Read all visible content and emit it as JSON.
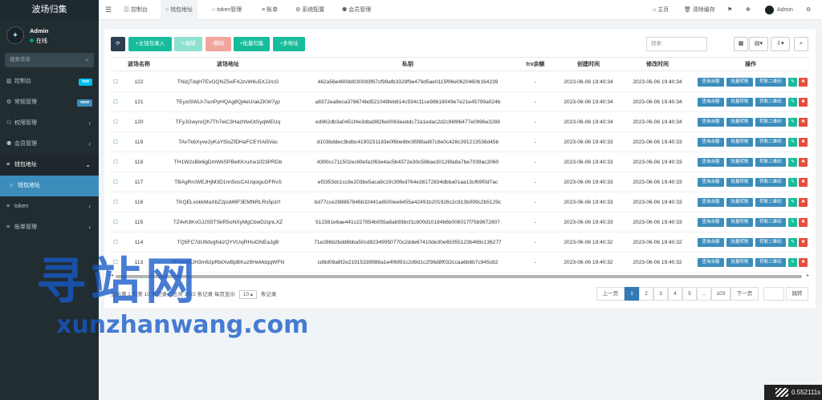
{
  "app": {
    "title": "波场归集"
  },
  "user": {
    "name": "Admin",
    "status": "在线"
  },
  "sidebar": {
    "search_placeholder": "搜索菜单",
    "items": [
      {
        "label": "控制台",
        "badge": "hot",
        "badge_color": "#00c0ef"
      },
      {
        "label": "常规管理",
        "badge": "new",
        "badge_color": "#3c8dbc"
      },
      {
        "label": "权限管理"
      },
      {
        "label": "会员管理"
      },
      {
        "label": "钱包地址"
      },
      {
        "label": "钱包地址"
      },
      {
        "label": "token"
      },
      {
        "label": "账单管理"
      }
    ]
  },
  "topbar": {
    "tabs": [
      "控制台",
      "钱包地址",
      "token管理",
      "账单",
      "系统配置",
      "会员管理"
    ],
    "home": "主页",
    "clear_cache": "清除缓存",
    "admin": "Admin"
  },
  "toolbar": {
    "add_main": "+主钱包录入",
    "edit": "编辑",
    "delete": "删除",
    "batch_collect": "+批量归集",
    "multi_address": "+多地址",
    "search_placeholder": "搜索"
  },
  "table": {
    "headers": [
      "波场名称",
      "波场地址",
      "私钥",
      "trx余额",
      "创建时间",
      "修改时间",
      "操作"
    ],
    "actions": {
      "query": "查询余额",
      "batch": "批量转账",
      "qrcode": "转账二维码"
    },
    "rows": [
      {
        "id": "122",
        "address": "TNizjTdqH7EvGQNZ5xiF4JzvW6u5XJJrcG",
        "key": "462a56e4808d030083f67cf99afb3328f9e479d5ae0115f96e0620460b164239",
        "trx": "-",
        "created": "2023-06-06 19:40:34",
        "modified": "2023-06-06 19:40:34"
      },
      {
        "id": "121",
        "address": "TEyxiSWLh7iunPpHQAg8Qj4eUrakZKW7yp",
        "key": "a8372ea8eca376674bd521048feb814c934c11ce98618049e7e21e45799a024b",
        "trx": "-",
        "created": "2023-06-06 19:40:34",
        "modified": "2023-06-06 19:40:34"
      },
      {
        "id": "120",
        "address": "TFyJGwyroQh7Th7eiC3HazhfwGtSyqWEUq",
        "key": "ed962db3a0451f4e3dba9826e0063eeddc72a1edac2d2c96f86477e0996e3288",
        "trx": "-",
        "created": "2023-06-06 19:40:34",
        "modified": "2023-06-06 19:40:34"
      },
      {
        "id": "119",
        "address": "TAvTkbXyve2yKaYt5oZfDHaFCEYlAi5Vac",
        "key": "d103bddec3bdbc4190231183e0f6be8bc95f8fad87c8e0c428c391213538d45b",
        "trx": "-",
        "created": "2023-06-06 19:40:33",
        "modified": "2023-06-06 19:40:33"
      },
      {
        "id": "118",
        "address": "TH1W2sBik6gDmWkSPBeKKruXw1if23PRDb",
        "key": "4390cc711502ec69efa1f63e4ac5b4372e30c586ae30126fa8a7be7039ac3060",
        "trx": "-",
        "created": "2023-06-06 19:40:33",
        "modified": "2023-06-06 19:40:33"
      },
      {
        "id": "117",
        "address": "TBAgRrcWEJHjM3D1nn5osCAUqoiguDFRvS",
        "key": "ef3353dc1cc8e203be5aca9c19c39fed764e38172834dbba01aa13cf69f0d7ac",
        "trx": "-",
        "created": "2023-06-06 19:40:33",
        "modified": "2023-06-06 19:40:33"
      },
      {
        "id": "116",
        "address": "TKQELxokkMaXbZ2psM6F3EMfkRLRs5pzrf",
        "key": "bd77cce288867846b32441a6500ee6455a42491b201926c2c913b099c2b5129c",
        "trx": "-",
        "created": "2023-06-06 19:40:33",
        "modified": "2023-06-06 19:40:33"
      },
      {
        "id": "115",
        "address": "TZ4vh3KvGJJS5TSkR5oNXyMgCbwD2qnLXZ",
        "key": "512381e6ae441c227854b055a8ab93bcf1c800d10184b6b006017f75b9672807",
        "trx": "-",
        "created": "2023-06-06 19:40:33",
        "modified": "2023-06-06 19:40:33"
      },
      {
        "id": "114",
        "address": "TQ5FC7dU8dvgfskzQYVUxjRHsiGNEaJgB",
        "key": "71e286b2bdd6bba50cd82349950770c2dde67410de30e65355123b468c136277",
        "trx": "-",
        "created": "2023-06-06 19:40:32",
        "modified": "2023-06-06 19:40:32"
      },
      {
        "id": "113",
        "address": "TF74W5JH3m62pRbtXwBpBKuz9HeMdqqWFN",
        "key": "cd6d08a8f2e21915339988a1e4f6991c2d9d1c2f36d8f032ccaa6b6b7c945c82",
        "trx": "-",
        "created": "2023-06-06 19:40:32",
        "modified": "2023-06-06 19:40:32"
      }
    ]
  },
  "pagination": {
    "info": "显示第 1 到第 10 条记录，总共 1022 条记录 每页显示",
    "page_size": "10",
    "records": "条记录",
    "prev": "上一页",
    "pages": [
      "1",
      "2",
      "3",
      "4",
      "5",
      "...",
      "103"
    ],
    "next": "下一页",
    "jump": "跳转"
  },
  "watermark": {
    "cn": "寻站网",
    "url": "xunzhanwang.com"
  },
  "timer": "0.552111s",
  "colors": {
    "sidebar_bg": "#222d32",
    "primary": "#3c8dbc",
    "success": "#18bc9c",
    "danger": "#e74c3c",
    "dark": "#2c3e50",
    "pink": "#f39c9c"
  }
}
